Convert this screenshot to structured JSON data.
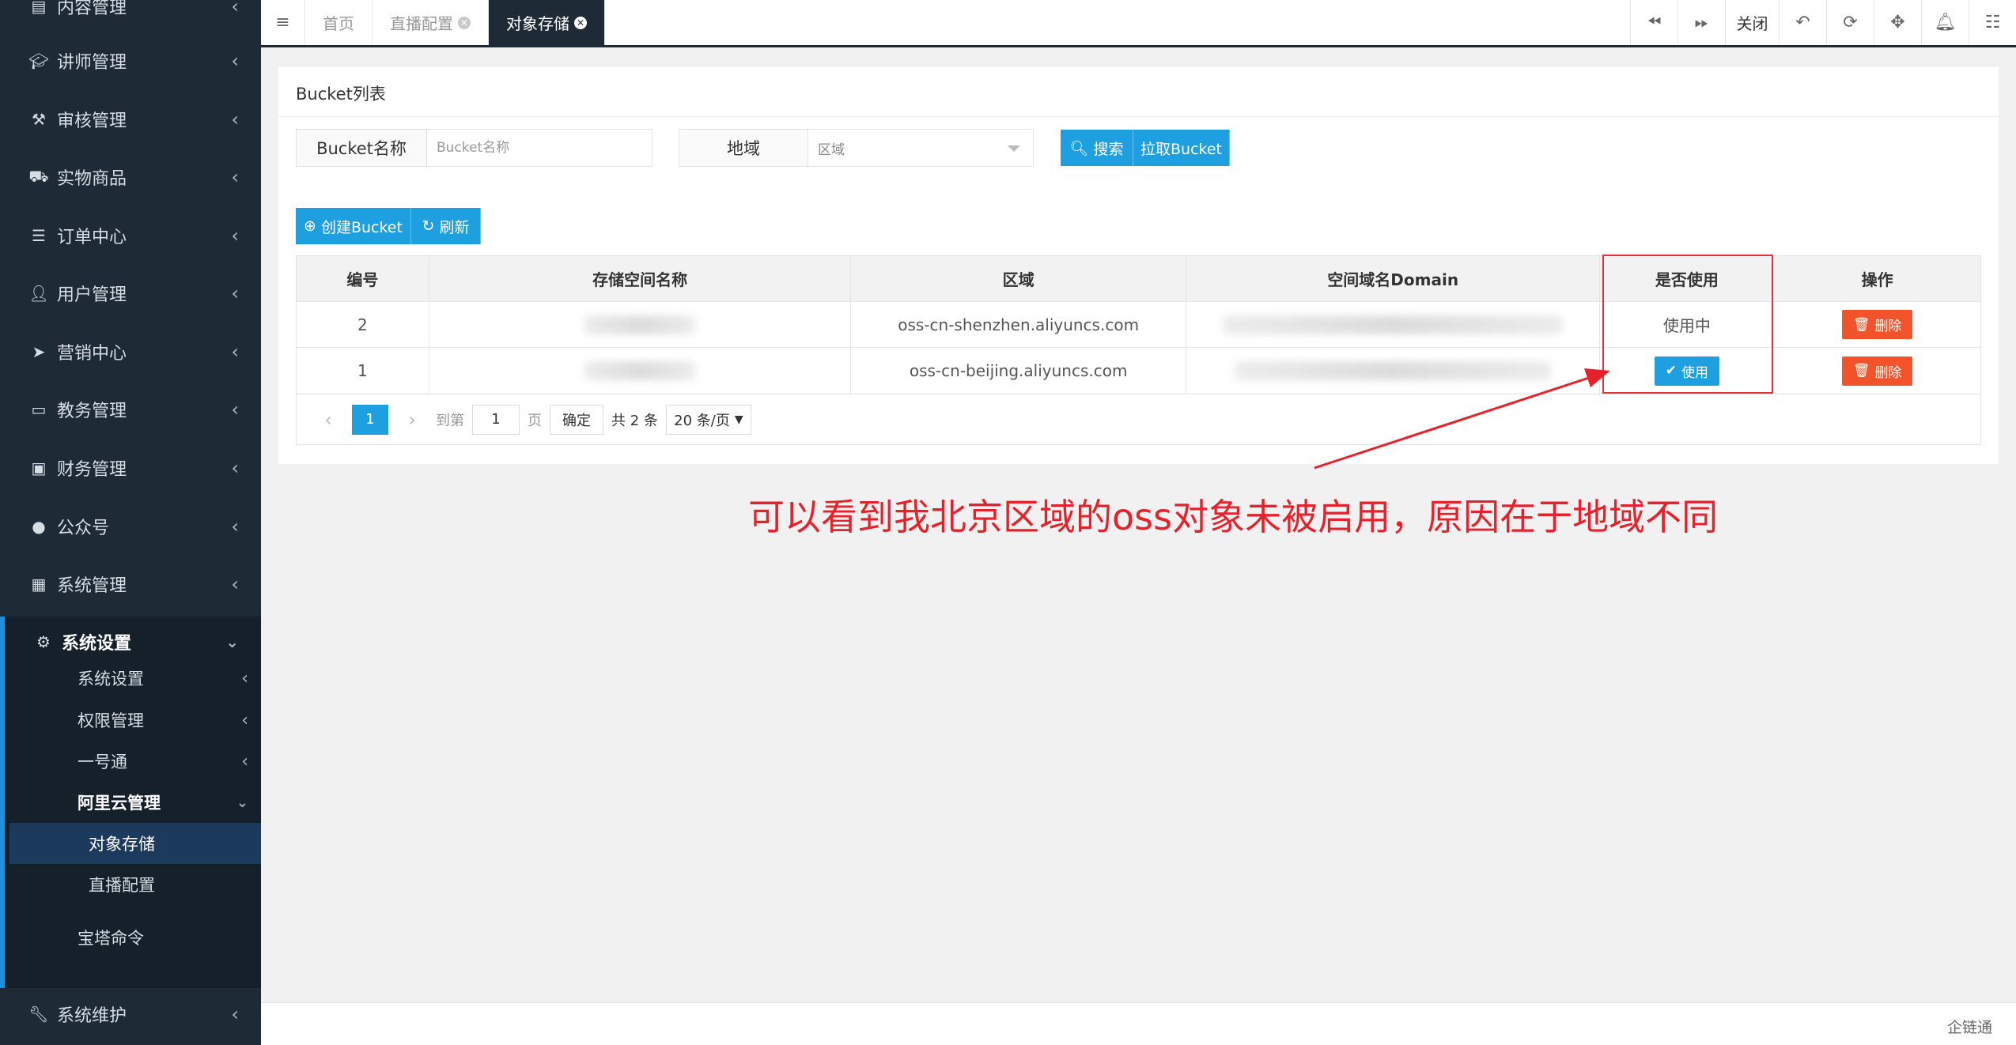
{
  "sidebar": {
    "items": [
      {
        "label": "内容管理",
        "icon": "content-icon"
      },
      {
        "label": "讲师管理",
        "icon": "graduation-cap-icon"
      },
      {
        "label": "审核管理",
        "icon": "gavel-icon"
      },
      {
        "label": "实物商品",
        "icon": "cart-icon"
      },
      {
        "label": "订单中心",
        "icon": "list-icon"
      },
      {
        "label": "用户管理",
        "icon": "user-icon"
      },
      {
        "label": "营销中心",
        "icon": "paper-plane-icon"
      },
      {
        "label": "教务管理",
        "icon": "book-icon"
      },
      {
        "label": "财务管理",
        "icon": "money-icon"
      },
      {
        "label": "公众号",
        "icon": "wechat-icon"
      },
      {
        "label": "系统管理",
        "icon": "grid-icon"
      },
      {
        "label": "系统设置",
        "icon": "gear-icon"
      },
      {
        "label": "系统维护",
        "icon": "wrench-icon"
      }
    ],
    "sub_items": [
      {
        "label": "系统设置"
      },
      {
        "label": "权限管理"
      },
      {
        "label": "一号通"
      },
      {
        "label": "阿里云管理"
      },
      {
        "label": "对象存储"
      },
      {
        "label": "直播配置"
      },
      {
        "label": "宝塔命令"
      }
    ]
  },
  "topbar": {
    "tabs": [
      {
        "label": "首页"
      },
      {
        "label": "直播配置"
      },
      {
        "label": "对象存储"
      }
    ],
    "close_label": "关闭"
  },
  "panel": {
    "title": "Bucket列表",
    "bucket_name_label": "Bucket名称",
    "bucket_name_placeholder": "Bucket名称",
    "region_label": "地域",
    "region_placeholder": "区域",
    "search_button": "搜索",
    "pull_button": "拉取Bucket",
    "create_button": "创建Bucket",
    "refresh_button": "刷新"
  },
  "table": {
    "columns": [
      "编号",
      "存储空间名称",
      "区域",
      "空间域名Domain",
      "是否使用",
      "操作"
    ],
    "rows": [
      {
        "id": "2",
        "region": "oss-cn-shenzhen.aliyuncs.com",
        "status": "使用中",
        "delete": "删除"
      },
      {
        "id": "1",
        "region": "oss-cn-beijing.aliyuncs.com",
        "use_button": "使用",
        "delete": "删除"
      }
    ]
  },
  "pager": {
    "current": "1",
    "goto_label": "到第",
    "goto_value": "1",
    "page_label": "页",
    "confirm": "确定",
    "total": "共 2 条",
    "page_size": "20 条/页"
  },
  "annotation": "可以看到我北京区域的oss对象未被启用，原因在于地域不同",
  "footer": "企链通",
  "colors": {
    "sidebar_bg": "#1e2a36",
    "accent": "#1e9fe0",
    "danger": "#f2532b",
    "annotation": "#e5222b"
  }
}
